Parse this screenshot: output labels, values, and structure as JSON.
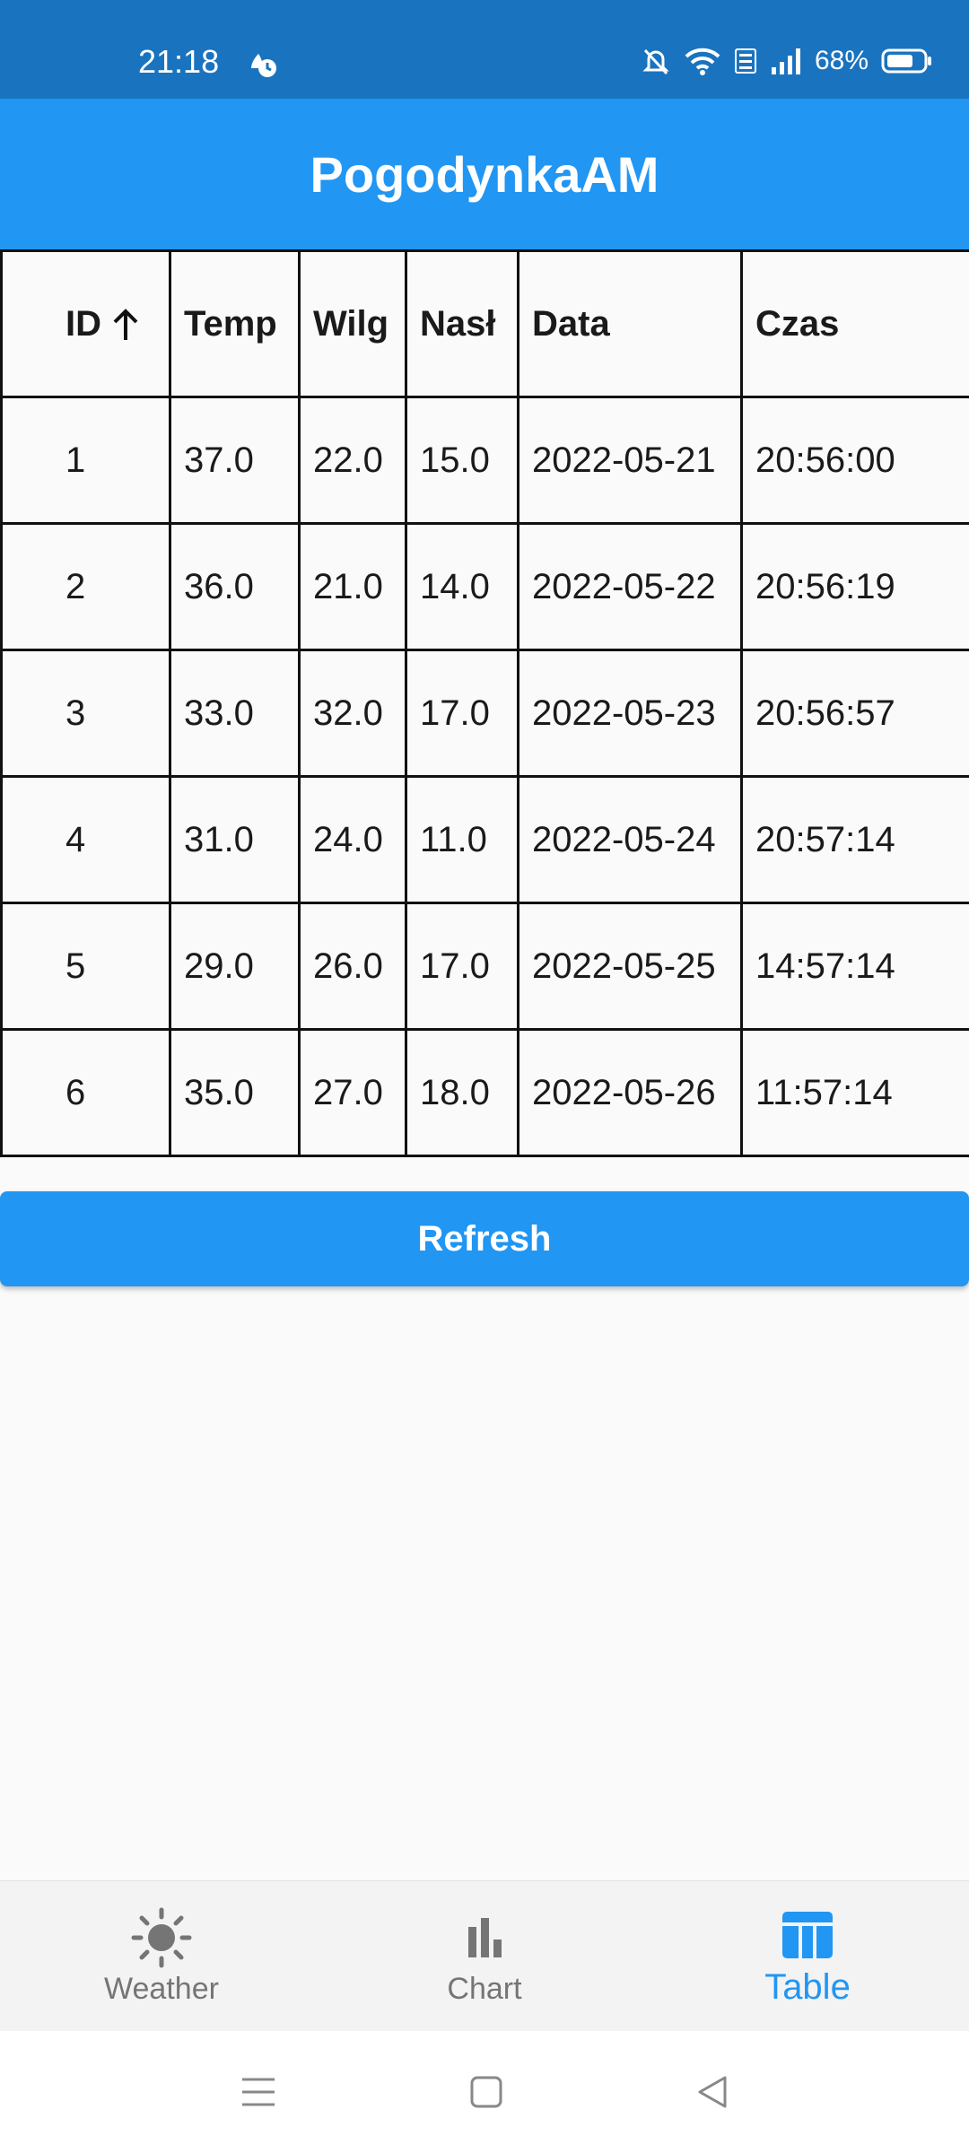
{
  "status_bar": {
    "time": "21:18",
    "battery": "68%",
    "icons": [
      "weather-status-icon",
      "bell-off-icon",
      "wifi-icon",
      "volte-icon",
      "signal-icon",
      "battery-icon"
    ]
  },
  "app_bar": {
    "title": "PogodynkaAM"
  },
  "table": {
    "headers": [
      "ID",
      "Temp",
      "Wilg",
      "Nasł",
      "Data",
      "Czas"
    ],
    "sort_icon": "arrow-up-icon",
    "rows": [
      [
        "1",
        "37.0",
        "22.0",
        "15.0",
        "2022-05-21",
        "20:56:00"
      ],
      [
        "2",
        "36.0",
        "21.0",
        "14.0",
        "2022-05-22",
        "20:56:19"
      ],
      [
        "3",
        "33.0",
        "32.0",
        "17.0",
        "2022-05-23",
        "20:56:57"
      ],
      [
        "4",
        "31.0",
        "24.0",
        "11.0",
        "2022-05-24",
        "20:57:14"
      ],
      [
        "5",
        "29.0",
        "26.0",
        "17.0",
        "2022-05-25",
        "14:57:14"
      ],
      [
        "6",
        "35.0",
        "27.0",
        "18.0",
        "2022-05-26",
        "11:57:14"
      ]
    ]
  },
  "refresh_button": {
    "label": "Refresh"
  },
  "bottom_nav": {
    "items": [
      {
        "label": "Weather",
        "icon": "sun-icon",
        "active": false
      },
      {
        "label": "Chart",
        "icon": "bar-chart-icon",
        "active": false
      },
      {
        "label": "Table",
        "icon": "table-icon",
        "active": true
      }
    ],
    "active_color": "#2196f3",
    "inactive_color": "#757575"
  },
  "colors": {
    "status_bar": "#1a73bf",
    "primary": "#2196f3",
    "background": "#fafafa"
  }
}
